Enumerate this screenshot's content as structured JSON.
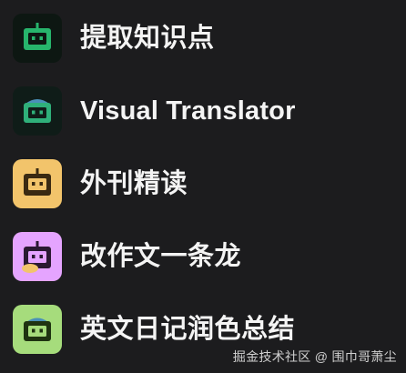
{
  "items": [
    {
      "label": "提取知识点",
      "icon": "robot-icon",
      "tile_color": "#0f1a14",
      "robot_color": "#27b56c"
    },
    {
      "label": "Visual Translator",
      "icon": "robot-icon",
      "tile_color": "#0f1a16",
      "robot_color": "#2fb07a"
    },
    {
      "label": "外刊精读",
      "icon": "robot-icon",
      "tile_color": "#f2c46b",
      "robot_color": "#3a2a12"
    },
    {
      "label": "改作文一条龙",
      "icon": "robot-icon",
      "tile_color": "#e5a4ff",
      "robot_color": "#2a1a32"
    },
    {
      "label": "英文日记润色总结",
      "icon": "robot-icon",
      "tile_color": "#a6dc7c",
      "robot_color": "#1f3311"
    }
  ],
  "watermark": "掘金技术社区 @ 围巾哥萧尘"
}
